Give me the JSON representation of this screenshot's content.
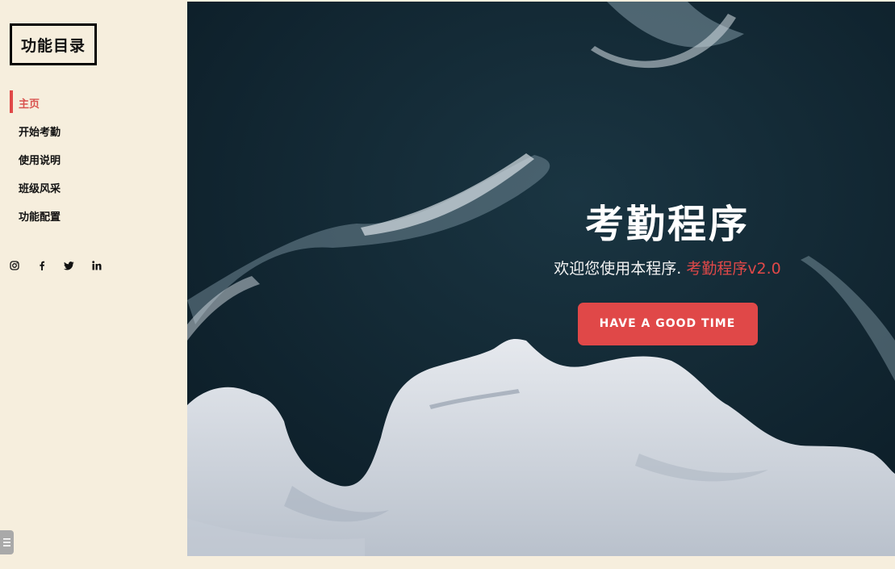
{
  "sidebar": {
    "logo_text": "功能目录",
    "nav_items": [
      {
        "label": "主页",
        "active": true
      },
      {
        "label": "开始考勤",
        "active": false
      },
      {
        "label": "使用说明",
        "active": false
      },
      {
        "label": "班级风采",
        "active": false
      },
      {
        "label": "功能配置",
        "active": false
      }
    ],
    "social_icons": [
      "instagram-icon",
      "facebook-icon",
      "twitter-icon",
      "linkedin-icon"
    ],
    "toggle_icon": "menu-icon"
  },
  "hero": {
    "title": "考勤程序",
    "subtitle_prefix": "欢迎您使用本程序.",
    "subtitle_accent": "考勤程序v2.0",
    "cta_label": "HAVE A GOOD TIME"
  },
  "colors": {
    "accent": "#e04848",
    "sidebar_bg": "#f6eedd",
    "ocean": "#10222d",
    "ice": "#d9dde3"
  }
}
